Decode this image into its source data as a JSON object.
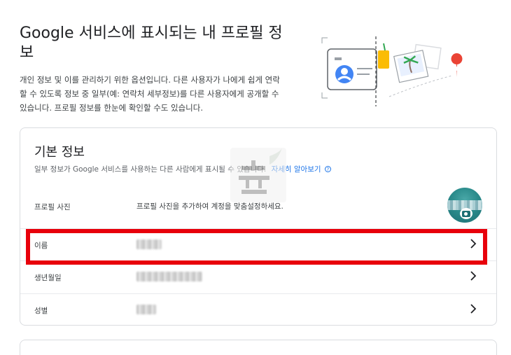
{
  "header": {
    "title": "Google 서비스에 표시되는 내 프로필 정보",
    "description": "개인 정보 및 이를 관리하기 위한 옵션입니다. 다른 사용자가 나에게 쉽게 연락할 수 있도록 정보 중 일부(예: 연락처 세부정보)를 다른 사용자에게 공개할 수 있습니다. 프로필 정보를 한눈에 확인할 수도 있습니다."
  },
  "basic_info": {
    "title": "기본 정보",
    "subtitle": "일부 정보가 Google 서비스를 사용하는 다른 사람에게 표시될 수 있습니다.",
    "learn_more": "자세히 알아보기",
    "help_glyph": "?",
    "photo_row": {
      "label": "프로필 사진",
      "value": "프로필 사진을 추가하여 계정을 맞춤설정하세요."
    },
    "rows": [
      {
        "label": "이름"
      },
      {
        "label": "생년월일"
      },
      {
        "label": "성별"
      }
    ]
  },
  "colors": {
    "highlight": "#e8000b",
    "link": "#1a73e8",
    "avatar": "#2b8c8c"
  }
}
